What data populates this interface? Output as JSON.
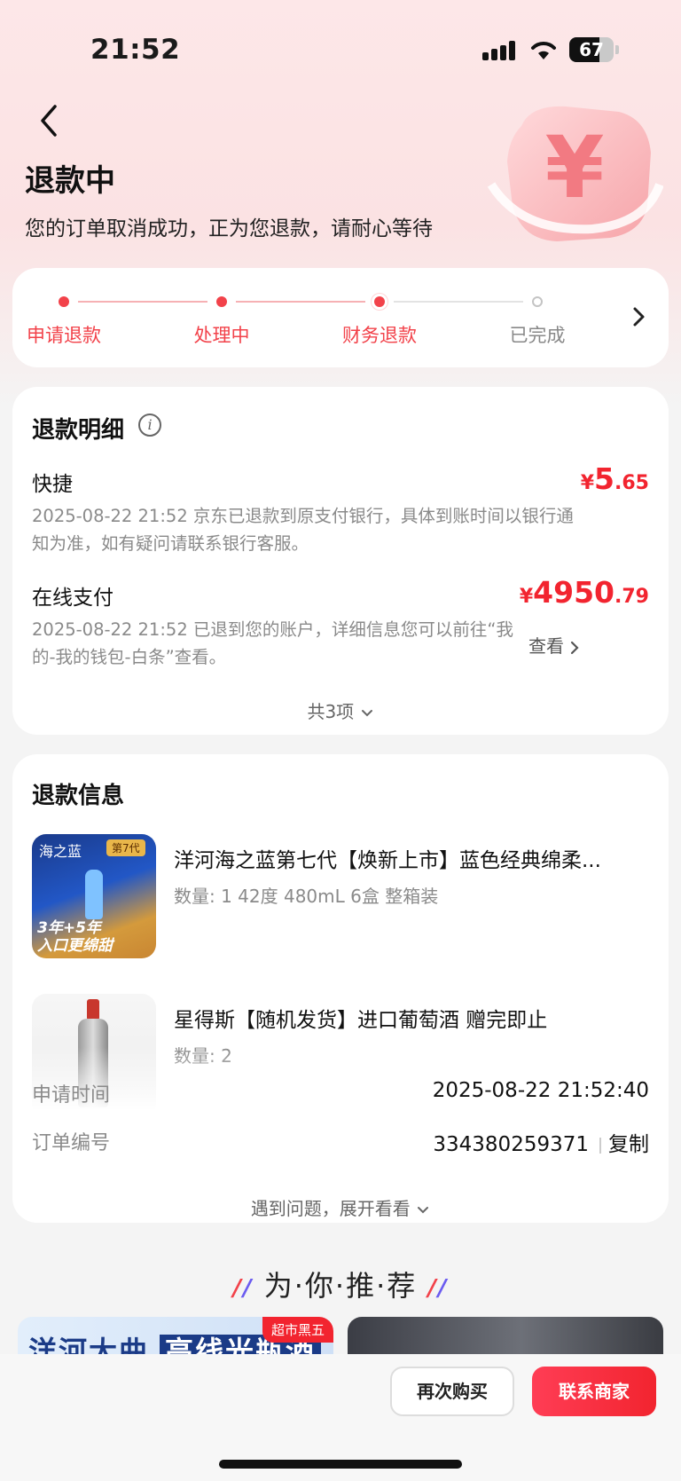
{
  "status_bar": {
    "time": "21:52",
    "battery": "67",
    "battery_level": 0.67
  },
  "header": {
    "title": "退款中",
    "subtitle": "您的订单取消成功，正为您退款，请耐心等待",
    "coin_symbol": "¥"
  },
  "progress": {
    "steps": [
      {
        "label": "申请退款",
        "state": "done"
      },
      {
        "label": "处理中",
        "state": "done"
      },
      {
        "label": "财务退款",
        "state": "current"
      },
      {
        "label": "已完成",
        "state": "pending"
      }
    ]
  },
  "refund_detail": {
    "title": "退款明细",
    "info_glyph": "i",
    "items": [
      {
        "method": "快捷",
        "amount_symbol": "¥",
        "amount_int": "5",
        "amount_dec": ".65",
        "desc": "2025-08-22 21:52 京东已退款到原支付银行，具体到账时间以银行通知为准，如有疑问请联系银行客服。"
      },
      {
        "method": "在线支付",
        "amount_symbol": "¥",
        "amount_int": "4950",
        "amount_dec": ".79",
        "desc": "2025-08-22 21:52 已退到您的账户，详细信息您可以前往“我的-我的钱包-白条”查看。",
        "link": "查看"
      }
    ],
    "total": "共3项"
  },
  "refund_info": {
    "title": "退款信息",
    "products": [
      {
        "title": "洋河海之蓝第七代【焕新上市】蓝色经典绵柔...",
        "spec": "数量: 1  42度 480mL 6盒 整箱装",
        "badge": "第7代",
        "thumb_text": "3年+5年\n入口更绵甜"
      },
      {
        "title": "星得斯【随机发货】进口葡萄酒 赠完即止",
        "spec": "数量: 2"
      }
    ],
    "apply_time_label": "申请时间",
    "apply_time": "2025-08-22 21:52:40",
    "order_no_label": "订单编号",
    "order_no": "334380259371",
    "copy_label": "复制",
    "expand_label": "遇到问题，展开看看"
  },
  "recommend": {
    "title": "为·你·推·荐",
    "card1_tag": "超市黑五",
    "card1_text": "洋河大曲",
    "card1_box": "高线光瓶酒"
  },
  "actions": {
    "buy_again": "再次购买",
    "contact": "联系商家"
  },
  "colors": {
    "accent": "#f2242f",
    "accent_soft": "#f6b1b4",
    "page_bg": "#f4f4f4"
  }
}
